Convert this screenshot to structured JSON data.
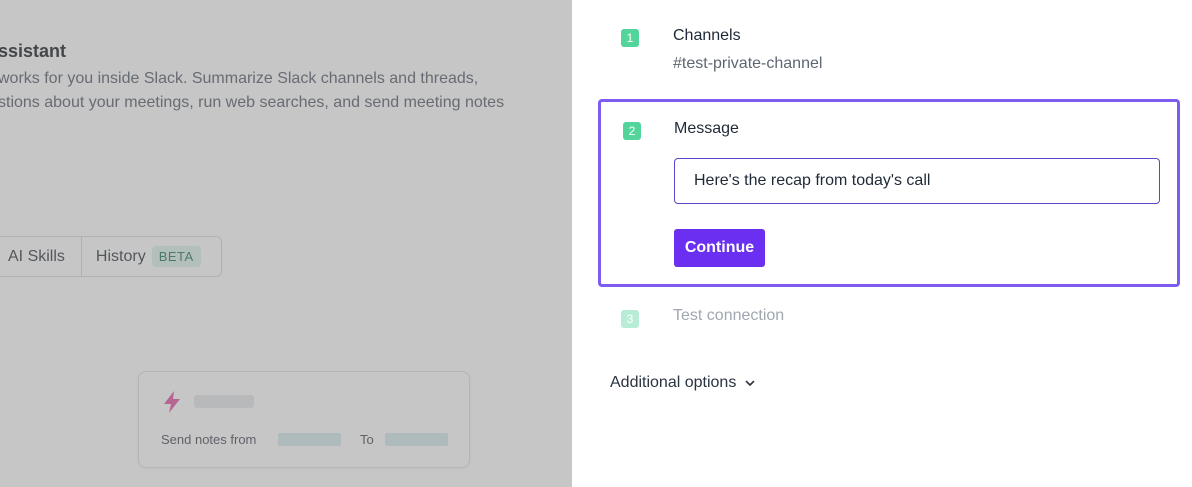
{
  "background_page": {
    "title": "ssistant",
    "description_lines": [
      "works for you inside Slack. Summarize Slack channels and threads,",
      "stions about your meetings, run web searches, and send meeting notes"
    ],
    "tabs": [
      {
        "label": "AI Skills"
      },
      {
        "label": "History",
        "badge": "BETA"
      }
    ],
    "card": {
      "send_notes_label": "Send notes from",
      "to_label": "To"
    }
  },
  "drawer": {
    "steps": [
      {
        "number": "1",
        "title": "Channels",
        "value": "#test-private-channel",
        "state": "complete"
      },
      {
        "number": "2",
        "title": "Message",
        "input_value": "Here's the recap from today's call",
        "state": "active"
      },
      {
        "number": "3",
        "title": "Test connection",
        "state": "pending"
      }
    ],
    "continue_label": "Continue",
    "additional_options_label": "Additional options"
  },
  "colors": {
    "accent": "#6a2ff0",
    "active_border": "#7e5cf2",
    "step_badge": "#52d49a",
    "step_badge_pending": "#b9ecd6"
  },
  "icons": {
    "card_icon": "lightning-bolt-icon",
    "options_icon": "chevron-down-icon"
  }
}
